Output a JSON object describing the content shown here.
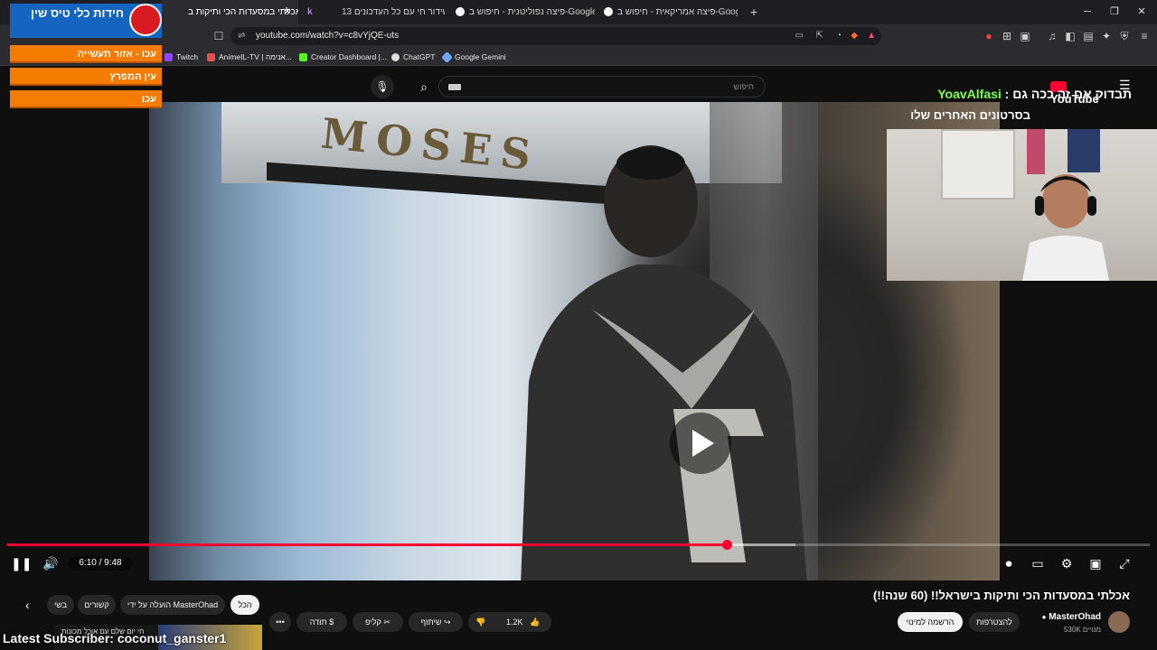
{
  "browser": {
    "tabs": [
      {
        "label": "אכלתי במסעדות הכי ותיקות ב"
      },
      {
        "label": ""
      },
      {
        "label": "שידור חי עם כל העדכונים 13+"
      },
      {
        "label": "פיצה נפוליטנית - חיפוש ב-Google"
      },
      {
        "label": "פיצה אמריקאית - חיפוש ב-Google"
      }
    ],
    "new_tab": "+",
    "url": "youtube.com/watch?v=c8vYjQE-uts",
    "bookmarks": [
      {
        "label": "Twitch"
      },
      {
        "label": "AnimeIL-TV | אנימה..."
      },
      {
        "label": "Creator Dashboard |..."
      },
      {
        "label": "ChatGPT"
      },
      {
        "label": "Google Gemini"
      }
    ]
  },
  "youtube": {
    "search_placeholder": "חיפוש",
    "logo_text": "YouTube",
    "video_title": "אכלתי במסעדות הכי ותיקות בישראל!! (60 שנה!!)",
    "time_display": "6:10 / 9:48",
    "progress": 0.63,
    "buffered": 0.69,
    "channel_name": "MasterOhad",
    "subscriber_count": "530K מנויים",
    "subscribe_label": "הרשמה למינוי",
    "join_label": "להצטרפות",
    "like_count": "1.2K",
    "share_label": "שיתוף",
    "clip_label": "קליפ",
    "thanks_label": "תודה",
    "more_label": "•••",
    "filter_chips": [
      "הכל",
      "הועלה על ידי MasterOhad",
      "קשורים",
      "בשי"
    ],
    "up_next_title": "חי יום שלם עם אוכל מכונות"
  },
  "overlay": {
    "quiz_title": "חידות כלי טיס שין",
    "quiz_rows": [
      "עכו - אזור תעשייה",
      "עין המפרץ",
      "עכו"
    ],
    "check_prefix": "תבדוק אם זה ככה גם :",
    "check_name": "YoavAlfasi",
    "recent_videos": "בסרטונים האחרים שלו",
    "latest_subscriber": "Latest Subscriber: coconut_ganster1"
  },
  "colors": {
    "accent_red": "#ff0033",
    "quiz_orange": "#f57c00",
    "quiz_blue": "#1565c0",
    "highlight_green": "#7dff4a"
  }
}
